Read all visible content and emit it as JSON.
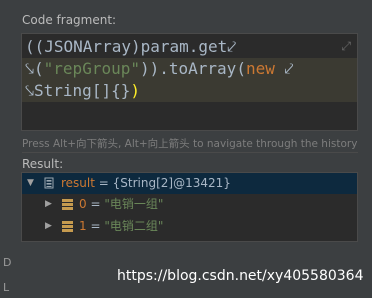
{
  "code_fragment_label": "Code fragment:",
  "code": {
    "line1": "((JSONArray)param.get",
    "line2_prefix": "(",
    "line2_string": "\"repGroup\"",
    "line2_mid": ")).toArray(",
    "line2_kw": "new",
    "line3_text": "String[]{}",
    "line3_paren": ")",
    "wrap_glyph": "⤦",
    "continue_glyph": "⤥"
  },
  "hint": "Press Alt+向下箭头, Alt+向上箭头 to navigate through the history",
  "result_label": "Result:",
  "tree": {
    "root": {
      "name": "result",
      "eq": " = ",
      "value": "{String[2]@13421}"
    },
    "items": [
      {
        "index": "0",
        "eq": " = ",
        "value": "\"电销一组\""
      },
      {
        "index": "1",
        "eq": " = ",
        "value": "\"电销二组\""
      }
    ]
  },
  "watermark": "https://blog.csdn.net/xy405580364",
  "edge_left_top": "D",
  "edge_left_bottom": "L"
}
